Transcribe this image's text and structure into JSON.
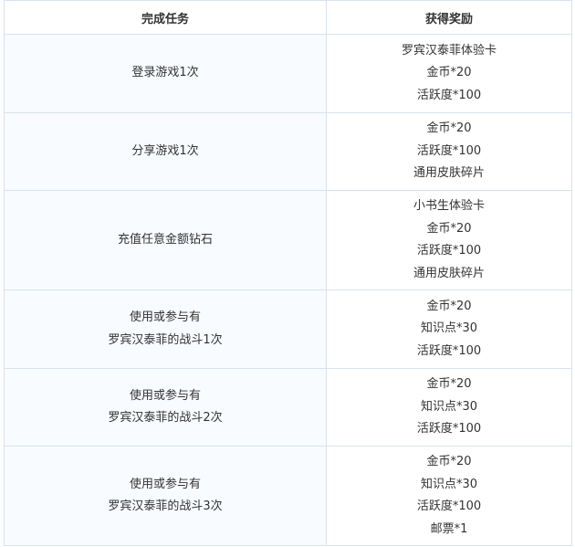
{
  "table": {
    "headers": {
      "task": "完成任务",
      "reward": "获得奖励"
    },
    "rows": [
      {
        "task": [
          "登录游戏1次"
        ],
        "rewards": [
          "罗宾汉泰菲体验卡",
          "金币*20",
          "活跃度*100"
        ]
      },
      {
        "task": [
          "分享游戏1次"
        ],
        "rewards": [
          "金币*20",
          "活跃度*100",
          "通用皮肤碎片"
        ]
      },
      {
        "task": [
          "充值任意金额钻石"
        ],
        "rewards": [
          "小书生体验卡",
          "金币*20",
          "活跃度*100",
          "通用皮肤碎片"
        ]
      },
      {
        "task": [
          "使用或参与有",
          "罗宾汉泰菲的战斗1次"
        ],
        "rewards": [
          "金币*20",
          "知识点*30",
          "活跃度*100"
        ]
      },
      {
        "task": [
          "使用或参与有",
          "罗宾汉泰菲的战斗2次"
        ],
        "rewards": [
          "金币*20",
          "知识点*30",
          "活跃度*100"
        ]
      },
      {
        "task": [
          "使用或参与有",
          "罗宾汉泰菲的战斗3次"
        ],
        "rewards": [
          "金币*20",
          "知识点*30",
          "活跃度*100",
          "邮票*1"
        ]
      }
    ]
  }
}
